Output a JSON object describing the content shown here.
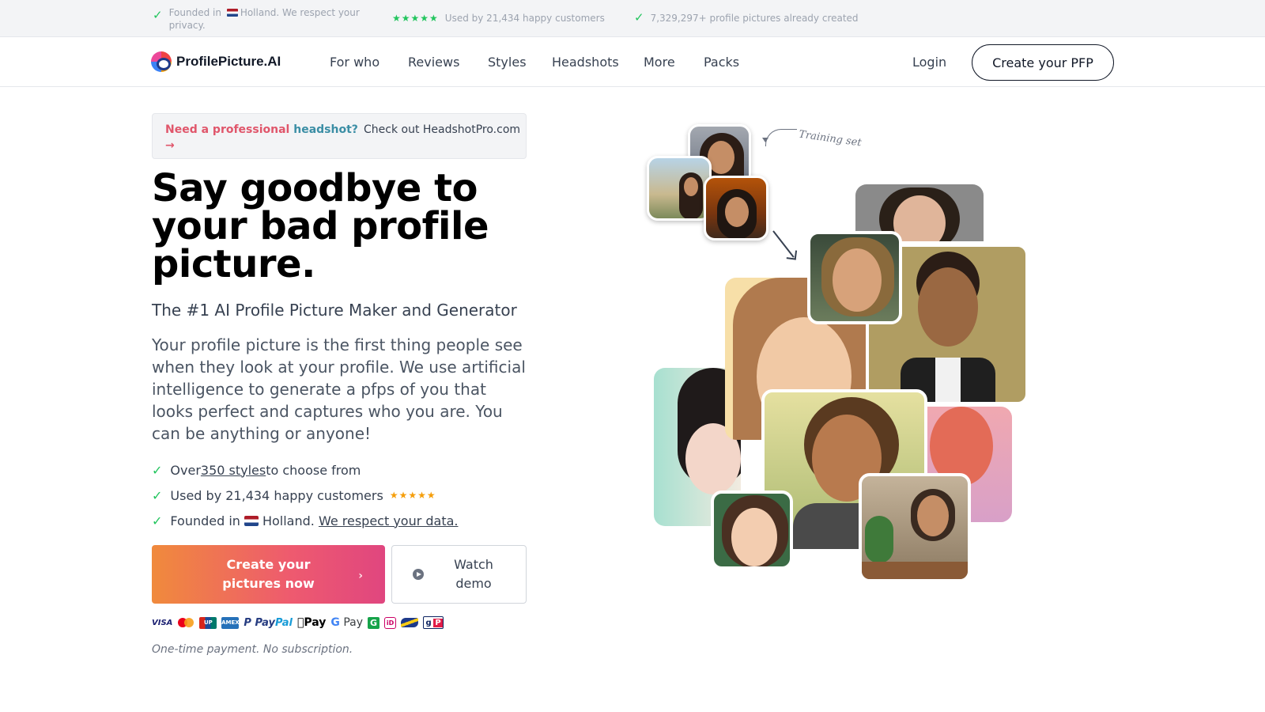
{
  "topbar": {
    "trust1": {
      "prefix": "Founded in",
      "suffix": "Holland. We respect your privacy."
    },
    "trust2": {
      "stars": "★★★★★",
      "text": "Used by 21,434 happy customers"
    },
    "trust3": {
      "text": "7,329,297+ profile pictures already created"
    }
  },
  "nav": {
    "logo": "ProfilePicture.AI",
    "items": [
      "For who",
      "Reviews",
      "Styles",
      "Headshots",
      "More",
      "Packs"
    ],
    "login": "Login",
    "cta": "Create your PFP"
  },
  "banner": {
    "part1": "Need a professional ",
    "part2": "headshot?",
    "arrow": "→",
    "right": "Check out HeadshotPro.com"
  },
  "hero": {
    "title": "Say goodbye to your bad profile picture.",
    "subtitle": "The #1 AI Profile Picture Maker and Generator",
    "description": "Your profile picture is the first thing people see when they look at your profile. We use artificial intelligence to generate a pfps of you that looks perfect and captures who you are. You can be anything or anyone!"
  },
  "checks": {
    "c1": {
      "pre": "Over ",
      "link": "350 styles ",
      "post": "to choose from"
    },
    "c2": {
      "text": "Used by 21,434 happy customers",
      "stars": "★★★★★"
    },
    "c3": {
      "pre": "Founded in",
      "mid": "Holland.",
      "link": "We respect your data."
    }
  },
  "buttons": {
    "primary": "Create your pictures now",
    "demo": "Watch demo"
  },
  "payments": {
    "visa": "VISA",
    "unionpay": "UP",
    "amex": "AMEX",
    "paypal_pay": "Pay",
    "paypal_pal": "Pal",
    "applepay": "Pay",
    "gpay_g": "G",
    "gpay_pay": "Pay",
    "giropay_a": "g",
    "giropay_b": "P"
  },
  "note": "One-time payment. No subscription.",
  "collage": {
    "label": "Training set"
  },
  "colors": {
    "accent_green": "#22c55e",
    "star_yellow": "#f59e0b",
    "cta_gradient_start": "#f08a3c",
    "cta_gradient_end": "#e0467f"
  },
  "icons": [
    "check-icon",
    "flag-nl-icon",
    "chevron-right-icon",
    "play-icon",
    "arrow-right-icon",
    "curved-arrow-icon",
    "down-arrow-icon"
  ]
}
